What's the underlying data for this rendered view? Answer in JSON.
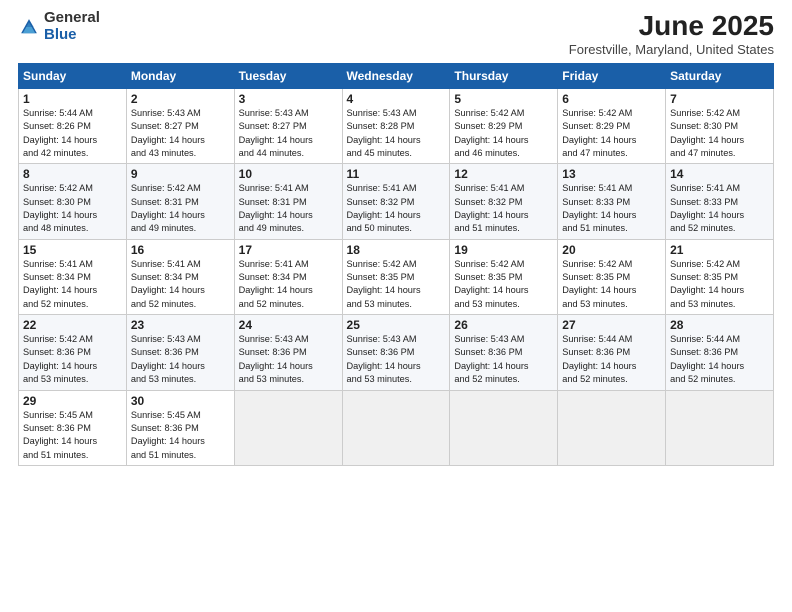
{
  "header": {
    "logo_general": "General",
    "logo_blue": "Blue",
    "month_title": "June 2025",
    "location": "Forestville, Maryland, United States"
  },
  "weekdays": [
    "Sunday",
    "Monday",
    "Tuesday",
    "Wednesday",
    "Thursday",
    "Friday",
    "Saturday"
  ],
  "weeks": [
    [
      {
        "day": "1",
        "sunrise": "5:44 AM",
        "sunset": "8:26 PM",
        "daylight": "14 hours and 42 minutes."
      },
      {
        "day": "2",
        "sunrise": "5:43 AM",
        "sunset": "8:27 PM",
        "daylight": "14 hours and 43 minutes."
      },
      {
        "day": "3",
        "sunrise": "5:43 AM",
        "sunset": "8:27 PM",
        "daylight": "14 hours and 44 minutes."
      },
      {
        "day": "4",
        "sunrise": "5:43 AM",
        "sunset": "8:28 PM",
        "daylight": "14 hours and 45 minutes."
      },
      {
        "day": "5",
        "sunrise": "5:42 AM",
        "sunset": "8:29 PM",
        "daylight": "14 hours and 46 minutes."
      },
      {
        "day": "6",
        "sunrise": "5:42 AM",
        "sunset": "8:29 PM",
        "daylight": "14 hours and 47 minutes."
      },
      {
        "day": "7",
        "sunrise": "5:42 AM",
        "sunset": "8:30 PM",
        "daylight": "14 hours and 47 minutes."
      }
    ],
    [
      {
        "day": "8",
        "sunrise": "5:42 AM",
        "sunset": "8:30 PM",
        "daylight": "14 hours and 48 minutes."
      },
      {
        "day": "9",
        "sunrise": "5:42 AM",
        "sunset": "8:31 PM",
        "daylight": "14 hours and 49 minutes."
      },
      {
        "day": "10",
        "sunrise": "5:41 AM",
        "sunset": "8:31 PM",
        "daylight": "14 hours and 49 minutes."
      },
      {
        "day": "11",
        "sunrise": "5:41 AM",
        "sunset": "8:32 PM",
        "daylight": "14 hours and 50 minutes."
      },
      {
        "day": "12",
        "sunrise": "5:41 AM",
        "sunset": "8:32 PM",
        "daylight": "14 hours and 51 minutes."
      },
      {
        "day": "13",
        "sunrise": "5:41 AM",
        "sunset": "8:33 PM",
        "daylight": "14 hours and 51 minutes."
      },
      {
        "day": "14",
        "sunrise": "5:41 AM",
        "sunset": "8:33 PM",
        "daylight": "14 hours and 52 minutes."
      }
    ],
    [
      {
        "day": "15",
        "sunrise": "5:41 AM",
        "sunset": "8:34 PM",
        "daylight": "14 hours and 52 minutes."
      },
      {
        "day": "16",
        "sunrise": "5:41 AM",
        "sunset": "8:34 PM",
        "daylight": "14 hours and 52 minutes."
      },
      {
        "day": "17",
        "sunrise": "5:41 AM",
        "sunset": "8:34 PM",
        "daylight": "14 hours and 52 minutes."
      },
      {
        "day": "18",
        "sunrise": "5:42 AM",
        "sunset": "8:35 PM",
        "daylight": "14 hours and 53 minutes."
      },
      {
        "day": "19",
        "sunrise": "5:42 AM",
        "sunset": "8:35 PM",
        "daylight": "14 hours and 53 minutes."
      },
      {
        "day": "20",
        "sunrise": "5:42 AM",
        "sunset": "8:35 PM",
        "daylight": "14 hours and 53 minutes."
      },
      {
        "day": "21",
        "sunrise": "5:42 AM",
        "sunset": "8:35 PM",
        "daylight": "14 hours and 53 minutes."
      }
    ],
    [
      {
        "day": "22",
        "sunrise": "5:42 AM",
        "sunset": "8:36 PM",
        "daylight": "14 hours and 53 minutes."
      },
      {
        "day": "23",
        "sunrise": "5:43 AM",
        "sunset": "8:36 PM",
        "daylight": "14 hours and 53 minutes."
      },
      {
        "day": "24",
        "sunrise": "5:43 AM",
        "sunset": "8:36 PM",
        "daylight": "14 hours and 53 minutes."
      },
      {
        "day": "25",
        "sunrise": "5:43 AM",
        "sunset": "8:36 PM",
        "daylight": "14 hours and 53 minutes."
      },
      {
        "day": "26",
        "sunrise": "5:43 AM",
        "sunset": "8:36 PM",
        "daylight": "14 hours and 52 minutes."
      },
      {
        "day": "27",
        "sunrise": "5:44 AM",
        "sunset": "8:36 PM",
        "daylight": "14 hours and 52 minutes."
      },
      {
        "day": "28",
        "sunrise": "5:44 AM",
        "sunset": "8:36 PM",
        "daylight": "14 hours and 52 minutes."
      }
    ],
    [
      {
        "day": "29",
        "sunrise": "5:45 AM",
        "sunset": "8:36 PM",
        "daylight": "14 hours and 51 minutes."
      },
      {
        "day": "30",
        "sunrise": "5:45 AM",
        "sunset": "8:36 PM",
        "daylight": "14 hours and 51 minutes."
      },
      null,
      null,
      null,
      null,
      null
    ]
  ]
}
